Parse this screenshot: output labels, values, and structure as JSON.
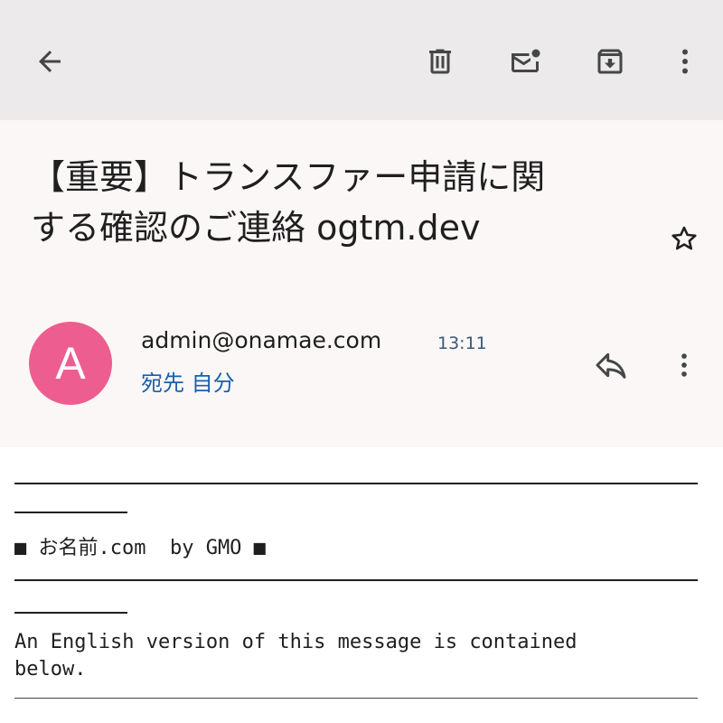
{
  "toolbar": {
    "back_icon": "arrow-left-icon",
    "delete_icon": "trash-icon",
    "mark_unread_icon": "mail-unread-icon",
    "archive_icon": "archive-icon",
    "more_icon": "more-vert-icon"
  },
  "message": {
    "subject_line1": "【重要】トランスファー申請に関",
    "subject_line2": "する確認のご連絡 ogtm.dev",
    "avatar_letter": "A",
    "avatar_color": "#ee5d8f",
    "sender": "admin@onamae.com",
    "time": "13:11",
    "recipient": "宛先 自分"
  },
  "body": {
    "brand_line": "■ お名前.com  by GMO ■",
    "english_line1": "An English version of this message is contained",
    "english_line2": "below."
  },
  "colors": {
    "toolbar_bg": "#eceaea",
    "header_bg": "#fbf7f7",
    "link_blue": "#1a5faa"
  }
}
